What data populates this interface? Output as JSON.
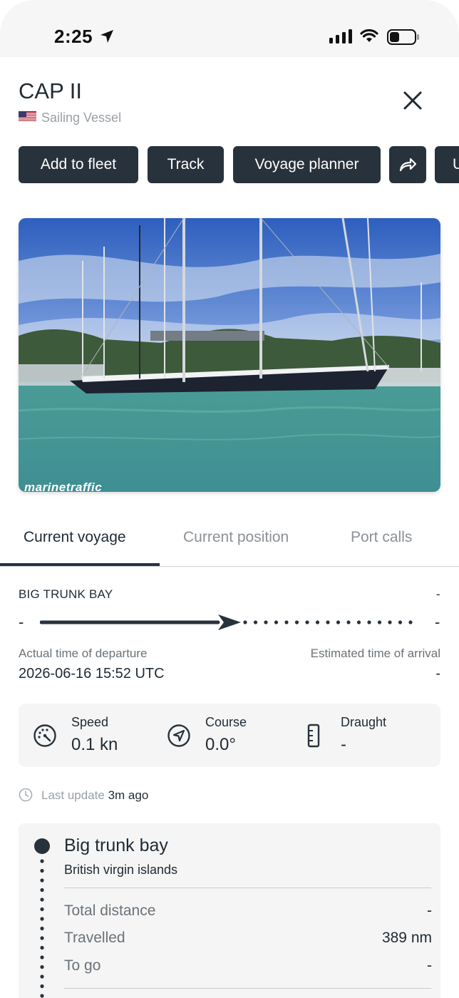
{
  "status_bar": {
    "time": "2:25"
  },
  "header": {
    "title": "CAP II",
    "subtitle": "Sailing Vessel",
    "flag": "us-flag-icon"
  },
  "actions": {
    "add_to_fleet": "Add to fleet",
    "track": "Track",
    "voyage_planner": "Voyage planner",
    "more_partial": "U"
  },
  "photo": {
    "watermark": "marinetraffic"
  },
  "tabs": [
    "Current voyage",
    "Current position",
    "Port calls"
  ],
  "voyage": {
    "from_port": "BIG TRUNK BAY",
    "to_port": "-",
    "from_dash": "-",
    "to_dash": "-",
    "atd_label": "Actual time of departure",
    "atd_value": "2026-06-16 15:52 UTC",
    "eta_label": "Estimated time of arrival",
    "eta_value": "-"
  },
  "stats": {
    "speed_label": "Speed",
    "speed_value": "0.1 kn",
    "course_label": "Course",
    "course_value": "0.0°",
    "draught_label": "Draught",
    "draught_value": "-"
  },
  "last_update": {
    "label": "Last update",
    "value": "3m ago"
  },
  "port_card": {
    "name": "Big trunk bay",
    "country": "British virgin islands",
    "total_distance_label": "Total distance",
    "total_distance_value": "-",
    "travelled_label": "Travelled",
    "travelled_value": "389 nm",
    "to_go_label": "To go",
    "to_go_value": "-"
  },
  "colors": {
    "button": "#28323c",
    "text": "#1f2a33",
    "muted": "#9aa0a6"
  }
}
